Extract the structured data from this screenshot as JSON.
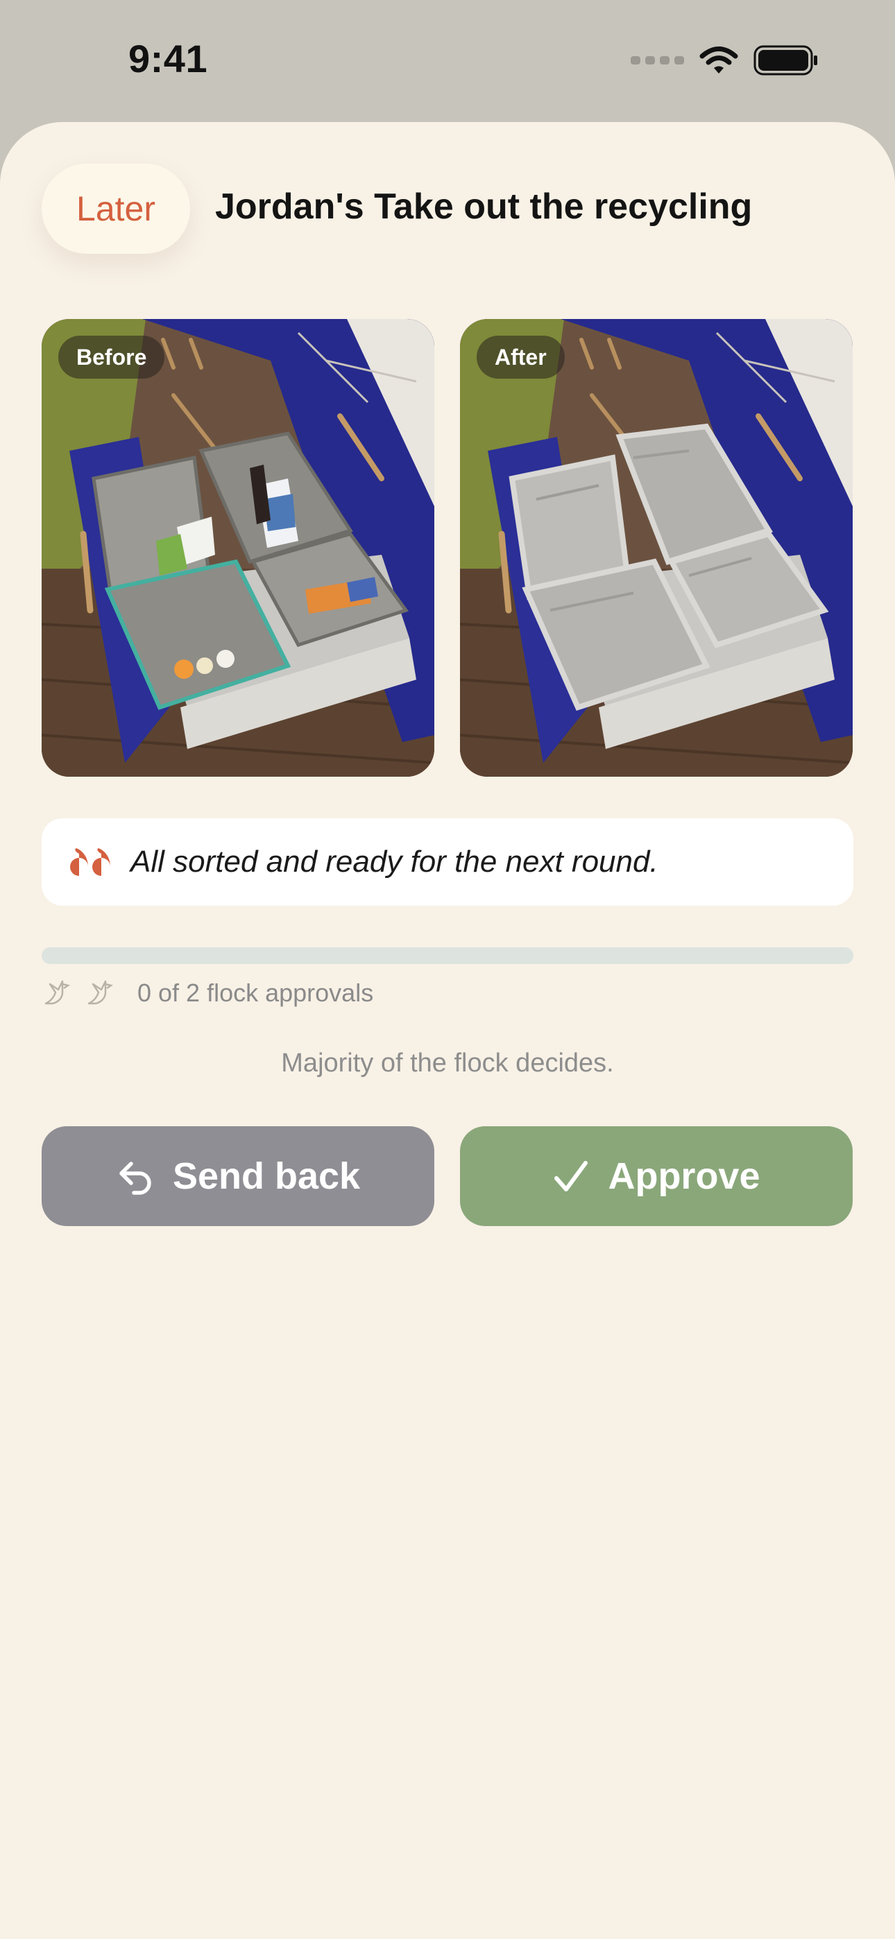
{
  "status_bar": {
    "time": "9:41",
    "icons": [
      "cellular-signal-icon",
      "wifi-icon",
      "battery-icon"
    ]
  },
  "header": {
    "later_label": "Later",
    "title": "Jordan's Take out the recycling"
  },
  "photos": [
    {
      "label": "Before",
      "content": "drawer with four recycling bins filled with cartons, a bottle and food packaging"
    },
    {
      "label": "After",
      "content": "drawer with four empty bins lined with fresh grey bags"
    }
  ],
  "note": {
    "icon": "quote-icon",
    "text": "All sorted and ready for the next round."
  },
  "approvals": {
    "approved": 0,
    "required": 2,
    "text": "0 of 2 flock approvals",
    "icon": "bird-icon"
  },
  "flock_note": "Majority of the flock decides.",
  "actions": {
    "send_back": {
      "label": "Send back",
      "icon": "undo-arrow-icon"
    },
    "approve": {
      "label": "Approve",
      "icon": "checkmark-icon"
    }
  },
  "colors": {
    "background": "#f8f1e6",
    "accent": "#d4603f",
    "approve": "#8aa77a",
    "send_back": "#8f8e94",
    "progress_track": "#dde3df"
  }
}
